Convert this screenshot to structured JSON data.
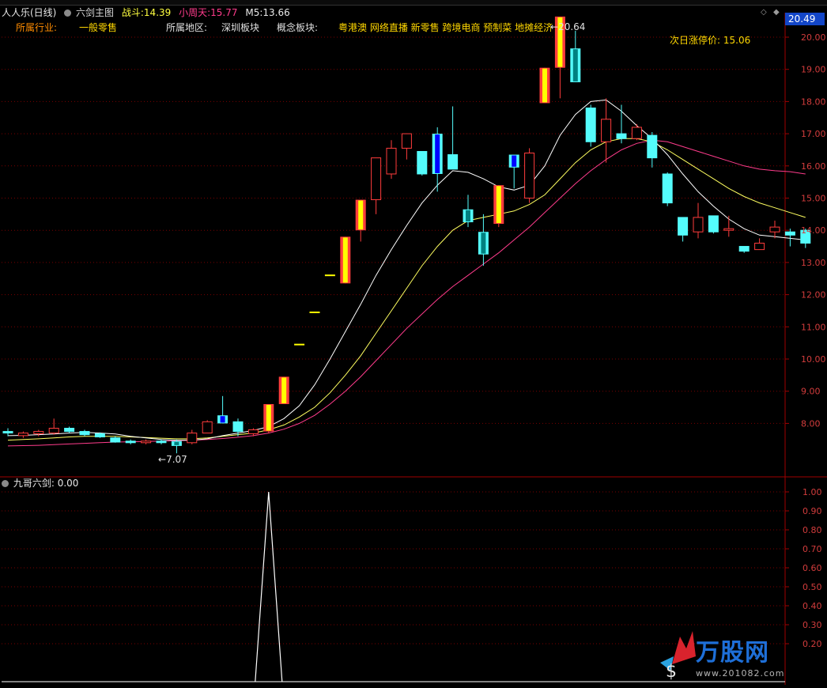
{
  "header": {
    "title": "人人乐(日线)",
    "indicator_name": "六剑主图",
    "zhandou_label": "战斗:",
    "zhandou_value": "14.39",
    "xiaozhoutian_label": "小周天:",
    "xiaozhoutian_value": "15.77",
    "m5_label": "M5:",
    "m5_value": "13.66",
    "current_price_box": "20.49"
  },
  "info": {
    "industry_label": "所属行业:",
    "industry_value": "一般零售",
    "region_label": "所属地区:",
    "region_value": "深圳板块",
    "concept_label": "概念板块:",
    "concept_value": "粤港澳 网络直播 新零售 跨境电商 预制菜 地摊经济",
    "limit_label": "次日涨停价:",
    "limit_value": "15.06"
  },
  "annotations": {
    "high": "20.64",
    "low": "7.07"
  },
  "lower": {
    "label": "九哥六剑",
    "value": ": 0.00"
  },
  "watermark": {
    "brand": "万股网",
    "site": "www.201082.com"
  },
  "colors": {
    "up": "#ff3c3c",
    "down": "#54fcfc",
    "signal_yellow": "#ffff00",
    "signal_blue": "#0000ff",
    "signal_teal": "#008080",
    "ma_white": "#ffffff",
    "ma_yellow": "#ffff60",
    "ma_pink": "#ff3c8c",
    "grid": "#7a0000",
    "axis": "#c8c8c8"
  },
  "chart_data": [
    {
      "type": "candlestick",
      "title": "人人乐(日线)",
      "ylim": [
        7.0,
        20.9
      ],
      "yticks": [
        "20.00",
        "19.00",
        "18.00",
        "17.00",
        "16.00",
        "15.00",
        "14.00",
        "13.00",
        "12.00",
        "11.00",
        "10.00",
        "9.00",
        "8.00"
      ],
      "tick_values": [
        20,
        19,
        18,
        17,
        16,
        15,
        14,
        13,
        12,
        11,
        10,
        9,
        8
      ],
      "candles": [
        {
          "o": 7.75,
          "h": 7.85,
          "l": 7.6,
          "c": 7.72,
          "s": "n"
        },
        {
          "o": 7.62,
          "h": 7.75,
          "l": 7.55,
          "c": 7.7,
          "s": "n"
        },
        {
          "o": 7.68,
          "h": 7.8,
          "l": 7.6,
          "c": 7.75,
          "s": "n"
        },
        {
          "o": 7.7,
          "h": 8.15,
          "l": 7.65,
          "c": 7.85,
          "s": "n"
        },
        {
          "o": 7.85,
          "h": 7.9,
          "l": 7.7,
          "c": 7.75,
          "s": "n"
        },
        {
          "o": 7.75,
          "h": 7.8,
          "l": 7.6,
          "c": 7.65,
          "s": "n"
        },
        {
          "o": 7.68,
          "h": 7.72,
          "l": 7.55,
          "c": 7.58,
          "s": "n"
        },
        {
          "o": 7.55,
          "h": 7.6,
          "l": 7.4,
          "c": 7.42,
          "s": "n"
        },
        {
          "o": 7.45,
          "h": 7.5,
          "l": 7.35,
          "c": 7.4,
          "s": "n"
        },
        {
          "o": 7.4,
          "h": 7.5,
          "l": 7.35,
          "c": 7.45,
          "s": "n"
        },
        {
          "o": 7.45,
          "h": 7.5,
          "l": 7.35,
          "c": 7.42,
          "s": "n"
        },
        {
          "o": 7.3,
          "h": 7.5,
          "l": 7.07,
          "c": 7.45,
          "s": "t"
        },
        {
          "o": 7.4,
          "h": 7.8,
          "l": 7.35,
          "c": 7.7,
          "s": "n"
        },
        {
          "o": 7.7,
          "h": 8.1,
          "l": 7.7,
          "c": 8.05,
          "s": "n"
        },
        {
          "o": 8.25,
          "h": 8.85,
          "l": 8.0,
          "c": 8.0,
          "s": "b"
        },
        {
          "o": 8.05,
          "h": 8.15,
          "l": 7.6,
          "c": 7.75,
          "s": "n"
        },
        {
          "o": 7.68,
          "h": 7.85,
          "l": 7.6,
          "c": 7.8,
          "s": "n"
        },
        {
          "o": 7.75,
          "h": 8.6,
          "l": 7.7,
          "c": 8.6,
          "s": "y"
        },
        {
          "o": 8.6,
          "h": 9.45,
          "l": 8.6,
          "c": 9.45,
          "s": "y"
        },
        {
          "o": 10.45,
          "h": 10.45,
          "l": 10.45,
          "c": 10.45,
          "s": "f"
        },
        {
          "o": 11.45,
          "h": 11.45,
          "l": 11.45,
          "c": 11.45,
          "s": "f"
        },
        {
          "o": 12.6,
          "h": 12.6,
          "l": 12.6,
          "c": 12.6,
          "s": "f"
        },
        {
          "o": 12.35,
          "h": 13.8,
          "l": 12.35,
          "c": 13.8,
          "s": "y"
        },
        {
          "o": 14.0,
          "h": 14.65,
          "l": 13.65,
          "c": 14.95,
          "s": "y"
        },
        {
          "o": 14.95,
          "h": 16.25,
          "l": 14.5,
          "c": 16.25,
          "s": "n"
        },
        {
          "o": 15.75,
          "h": 16.8,
          "l": 15.6,
          "c": 16.55,
          "s": "n"
        },
        {
          "o": 16.55,
          "h": 17.0,
          "l": 16.2,
          "c": 17.0,
          "s": "n"
        },
        {
          "o": 16.45,
          "h": 16.45,
          "l": 15.7,
          "c": 15.75,
          "s": "n"
        },
        {
          "o": 15.75,
          "h": 17.2,
          "l": 15.2,
          "c": 17.0,
          "s": "b"
        },
        {
          "o": 16.35,
          "h": 17.85,
          "l": 15.9,
          "c": 15.9,
          "s": "n"
        },
        {
          "o": 14.65,
          "h": 15.1,
          "l": 14.1,
          "c": 14.25,
          "s": "t"
        },
        {
          "o": 13.95,
          "h": 14.5,
          "l": 12.9,
          "c": 13.25,
          "s": "t"
        },
        {
          "o": 14.2,
          "h": 15.4,
          "l": 14.1,
          "c": 15.4,
          "s": "y"
        },
        {
          "o": 15.95,
          "h": 16.1,
          "l": 15.3,
          "c": 16.35,
          "s": "b"
        },
        {
          "o": 15.0,
          "h": 16.55,
          "l": 14.85,
          "c": 16.4,
          "s": "n"
        },
        {
          "o": 17.95,
          "h": 19.05,
          "l": 17.95,
          "c": 19.05,
          "s": "y"
        },
        {
          "o": 19.05,
          "h": 20.64,
          "l": 18.1,
          "c": 20.64,
          "s": "y"
        },
        {
          "o": 19.65,
          "h": 20.2,
          "l": 18.6,
          "c": 18.6,
          "s": "t"
        },
        {
          "o": 17.8,
          "h": 17.9,
          "l": 16.6,
          "c": 16.75,
          "s": "n"
        },
        {
          "o": 16.75,
          "h": 18.1,
          "l": 16.1,
          "c": 17.45,
          "s": "n"
        },
        {
          "o": 17.0,
          "h": 17.9,
          "l": 16.7,
          "c": 16.85,
          "s": "n"
        },
        {
          "o": 16.85,
          "h": 17.3,
          "l": 16.8,
          "c": 17.2,
          "s": "n"
        },
        {
          "o": 16.95,
          "h": 17.05,
          "l": 15.95,
          "c": 16.25,
          "s": "n"
        },
        {
          "o": 15.75,
          "h": 15.8,
          "l": 14.75,
          "c": 14.85,
          "s": "n"
        },
        {
          "o": 14.4,
          "h": 14.4,
          "l": 13.65,
          "c": 13.85,
          "s": "n"
        },
        {
          "o": 13.95,
          "h": 14.85,
          "l": 13.75,
          "c": 14.4,
          "s": "n"
        },
        {
          "o": 14.45,
          "h": 14.45,
          "l": 13.9,
          "c": 13.95,
          "s": "n"
        },
        {
          "o": 14.05,
          "h": 14.45,
          "l": 13.8,
          "c": 14.05,
          "s": "n"
        },
        {
          "o": 13.5,
          "h": 13.5,
          "l": 13.3,
          "c": 13.35,
          "s": "n"
        },
        {
          "o": 13.4,
          "h": 13.75,
          "l": 13.4,
          "c": 13.6,
          "s": "n"
        },
        {
          "o": 13.95,
          "h": 14.3,
          "l": 13.75,
          "c": 14.1,
          "s": "n"
        },
        {
          "o": 13.95,
          "h": 14.05,
          "l": 13.5,
          "c": 13.85,
          "s": "n"
        },
        {
          "o": 14.0,
          "h": 14.05,
          "l": 13.45,
          "c": 13.6,
          "s": "n"
        }
      ],
      "ma_white": [
        7.62,
        7.63,
        7.65,
        7.67,
        7.7,
        7.72,
        7.7,
        7.67,
        7.6,
        7.55,
        7.5,
        7.48,
        7.48,
        7.52,
        7.62,
        7.7,
        7.78,
        7.9,
        8.15,
        8.55,
        9.2,
        10.0,
        10.85,
        11.7,
        12.6,
        13.4,
        14.15,
        14.85,
        15.4,
        15.85,
        15.8,
        15.6,
        15.35,
        15.25,
        15.4,
        16.0,
        16.95,
        17.6,
        18.0,
        18.05,
        17.7,
        17.25,
        16.85,
        16.35,
        15.75,
        15.2,
        14.75,
        14.35,
        14.05,
        13.85,
        13.8,
        13.75,
        13.7
      ],
      "ma_yellow": [
        7.48,
        7.5,
        7.52,
        7.55,
        7.58,
        7.6,
        7.6,
        7.6,
        7.58,
        7.56,
        7.54,
        7.52,
        7.52,
        7.55,
        7.6,
        7.65,
        7.7,
        7.8,
        7.95,
        8.2,
        8.5,
        8.95,
        9.5,
        10.1,
        10.8,
        11.5,
        12.2,
        12.9,
        13.5,
        14.0,
        14.3,
        14.4,
        14.5,
        14.6,
        14.8,
        15.1,
        15.6,
        16.1,
        16.5,
        16.75,
        16.85,
        16.85,
        16.75,
        16.5,
        16.2,
        15.9,
        15.6,
        15.3,
        15.05,
        14.85,
        14.7,
        14.55,
        14.4
      ],
      "ma_pink": [
        7.3,
        7.31,
        7.32,
        7.34,
        7.36,
        7.38,
        7.4,
        7.42,
        7.43,
        7.44,
        7.45,
        7.46,
        7.48,
        7.5,
        7.53,
        7.57,
        7.62,
        7.7,
        7.82,
        8.0,
        8.25,
        8.6,
        9.0,
        9.45,
        9.95,
        10.45,
        10.95,
        11.4,
        11.85,
        12.25,
        12.6,
        12.95,
        13.3,
        13.7,
        14.1,
        14.55,
        15.0,
        15.45,
        15.85,
        16.2,
        16.5,
        16.7,
        16.8,
        16.75,
        16.6,
        16.45,
        16.3,
        16.15,
        16.0,
        15.9,
        15.85,
        15.82,
        15.75
      ]
    },
    {
      "type": "line",
      "title": "九哥六剑",
      "ylim": [
        0,
        1.0
      ],
      "yticks": [
        "1.00",
        "0.90",
        "0.80",
        "0.70",
        "0.60",
        "0.50",
        "0.40",
        "0.30",
        "0.20"
      ],
      "tick_values": [
        1.0,
        0.9,
        0.8,
        0.7,
        0.6,
        0.5,
        0.4,
        0.3,
        0.2
      ],
      "values": [
        0,
        0,
        0,
        0,
        0,
        0,
        0,
        0,
        0,
        0,
        0,
        0,
        0,
        0,
        0,
        0,
        0,
        1,
        0,
        0,
        0,
        0,
        0,
        0,
        0,
        0,
        0,
        0,
        0,
        0,
        0,
        0,
        0,
        0,
        0,
        0,
        0,
        0,
        0,
        0,
        0,
        0,
        0,
        0,
        0,
        0,
        0,
        0,
        0,
        0,
        0,
        0,
        0
      ]
    }
  ]
}
